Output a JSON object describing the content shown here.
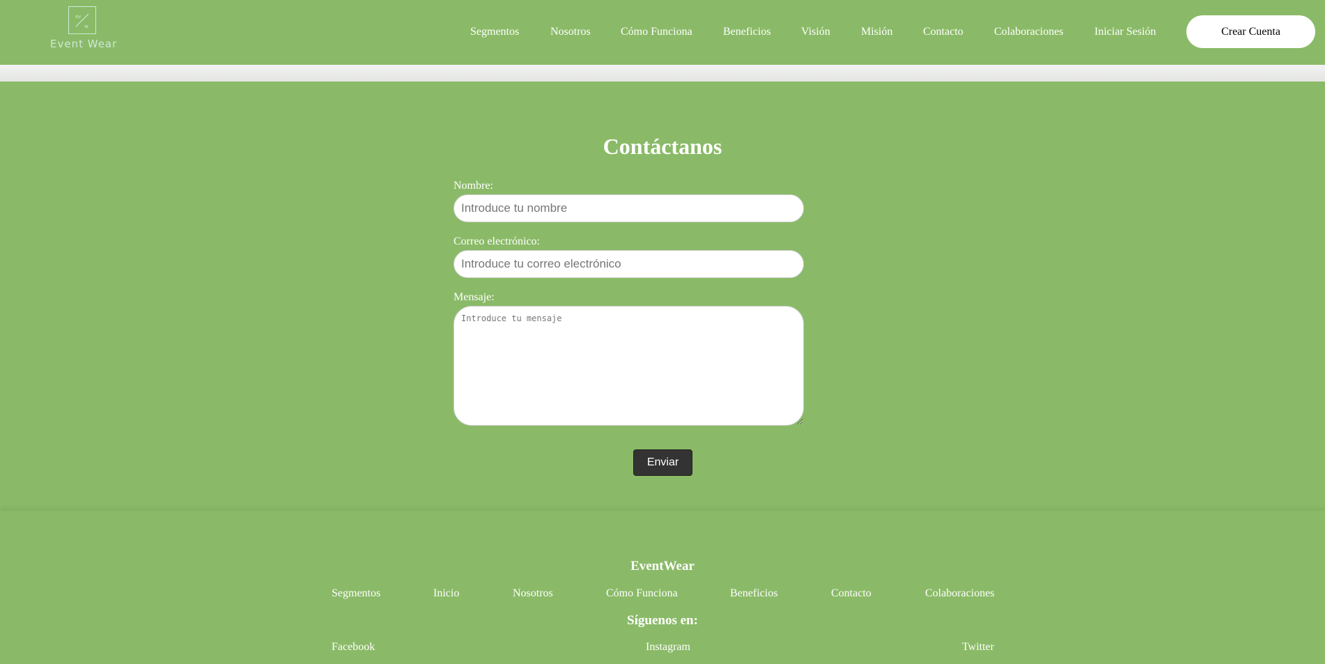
{
  "header": {
    "brand": "Event Wear",
    "nav": [
      "Segmentos",
      "Nosotros",
      "Cómo Funciona",
      "Beneficios",
      "Visión",
      "Misión",
      "Contacto",
      "Colaboraciones",
      "Iniciar Sesión"
    ],
    "cta_label": "Crear Cuenta"
  },
  "contact": {
    "title": "Contáctanos",
    "name_label": "Nombre:",
    "name_placeholder": "Introduce tu nombre",
    "email_label": "Correo electrónico:",
    "email_placeholder": "Introduce tu correo electrónico",
    "message_label": "Mensaje:",
    "message_placeholder": "Introduce tu mensaje",
    "submit_label": "Enviar"
  },
  "footer": {
    "brand": "EventWear",
    "links": [
      "Segmentos",
      "Inicio",
      "Nosotros",
      "Cómo Funciona",
      "Beneficios",
      "Contacto",
      "Colaboraciones"
    ],
    "follow_title": "Síguenos en:",
    "social": [
      "Facebook",
      "Instagram",
      "Twitter"
    ]
  },
  "colors": {
    "background": "#8aba67",
    "text": "#ffffff",
    "cta_bg": "#ffffff",
    "submit_bg": "#333333"
  }
}
